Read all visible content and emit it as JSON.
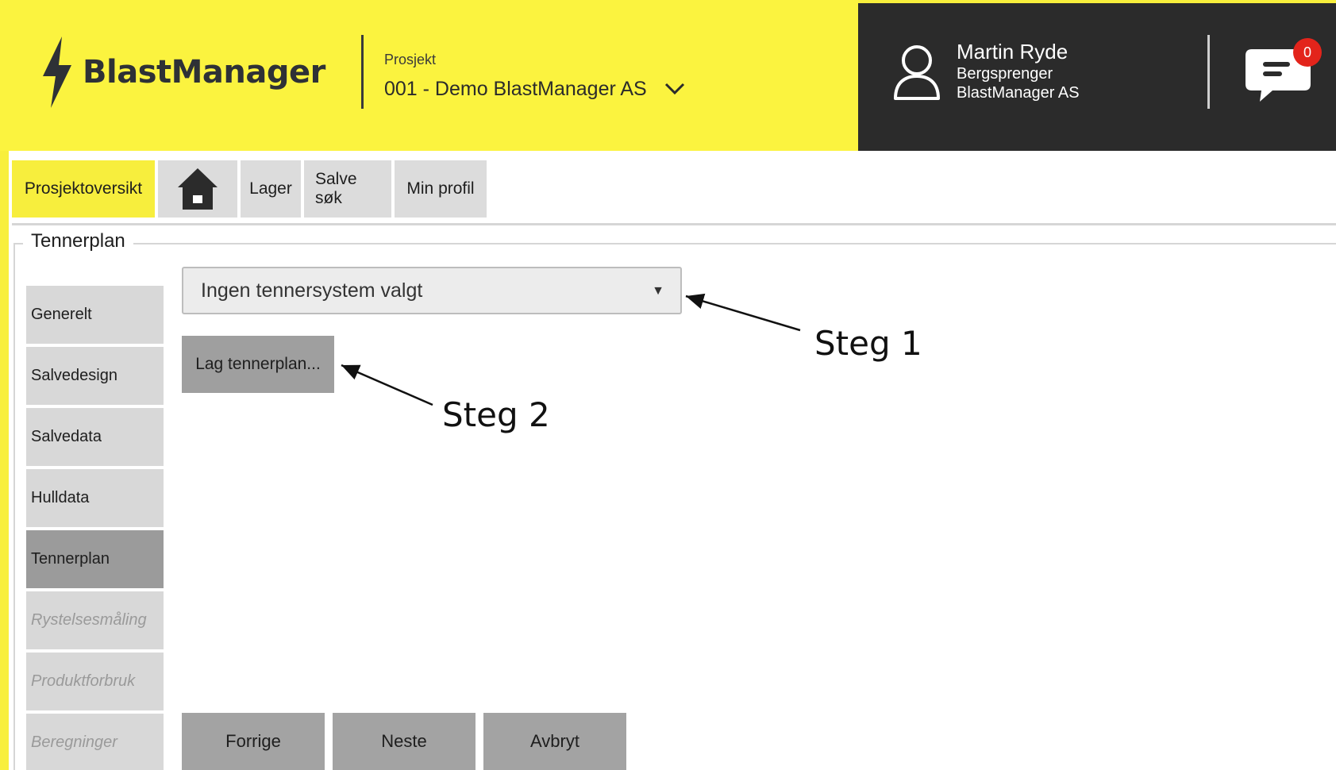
{
  "header": {
    "logo_text": "BlastManager",
    "project_label": "Prosjekt",
    "project_value": "001 - Demo BlastManager AS",
    "user": {
      "name": "Martin Ryde",
      "role": "Bergsprenger",
      "company": "BlastManager AS"
    },
    "chat_badge": "0",
    "colors": {
      "yellow": "#fbf33f",
      "dark": "#2b2b2b",
      "badge": "#e3241b"
    }
  },
  "nav": {
    "items": [
      {
        "label": "Prosjektoversikt",
        "active": true
      },
      {
        "label": "",
        "icon": "home-icon"
      },
      {
        "label": "Lager"
      },
      {
        "label": "Salve søk"
      },
      {
        "label": "Min profil"
      }
    ]
  },
  "section": {
    "legend": "Tennerplan"
  },
  "sidebar": {
    "items": [
      {
        "label": "Generelt"
      },
      {
        "label": "Salvedesign"
      },
      {
        "label": "Salvedata"
      },
      {
        "label": "Hulldata"
      },
      {
        "label": "Tennerplan",
        "active": true
      },
      {
        "label": "Rystelsesmåling",
        "disabled": true
      },
      {
        "label": "Produktforbruk",
        "disabled": true
      },
      {
        "label": "Beregninger",
        "disabled": true
      }
    ]
  },
  "content": {
    "tennersystem_select": "Ingen tennersystem valgt",
    "lag_button": "Lag tennerplan..."
  },
  "footer": {
    "prev": "Forrige",
    "next": "Neste",
    "cancel": "Avbryt"
  },
  "annotations": {
    "step1": "Steg 1",
    "step2": "Steg 2"
  }
}
